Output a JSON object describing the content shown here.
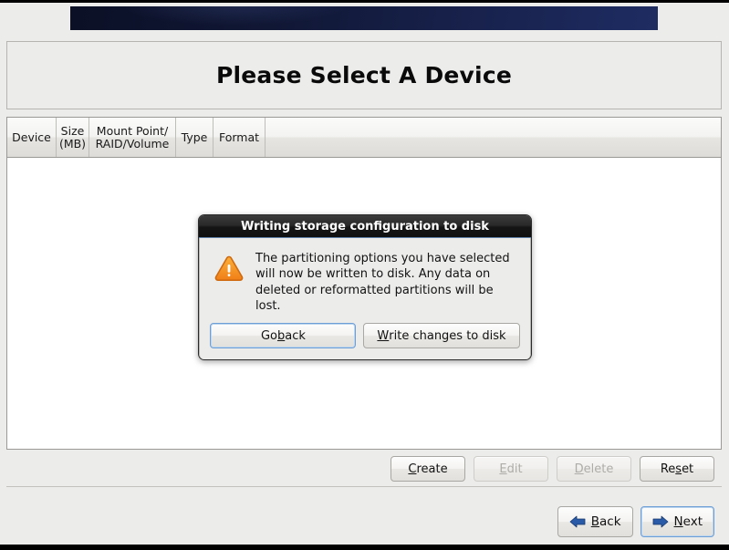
{
  "banner": {
    "name": "top-gradient-banner",
    "color": "#101735"
  },
  "header": {
    "title": "Please Select A Device"
  },
  "table": {
    "columns": [
      {
        "label": "Device"
      },
      {
        "label": "Size\n(MB)"
      },
      {
        "label": "Mount Point/\nRAID/Volume"
      },
      {
        "label": "Type"
      },
      {
        "label": "Format"
      }
    ],
    "rows": []
  },
  "actions": {
    "create": {
      "label_pre": "",
      "label_key": "C",
      "label_post": "reate",
      "disabled": false
    },
    "edit": {
      "label_pre": "",
      "label_key": "E",
      "label_post": "dit",
      "disabled": true
    },
    "delete": {
      "label_pre": "",
      "label_key": "D",
      "label_post": "elete",
      "disabled": true
    },
    "reset": {
      "label_pre": "Re",
      "label_key": "s",
      "label_post": "et",
      "disabled": false
    }
  },
  "nav": {
    "back": {
      "label_pre": "",
      "label_key": "B",
      "label_post": "ack",
      "icon": "arrow-left-icon",
      "focused": false
    },
    "next": {
      "label_pre": "",
      "label_key": "N",
      "label_post": "ext",
      "icon": "arrow-right-icon",
      "focused": true
    },
    "arrow_color": "#2a5ba8"
  },
  "dialog": {
    "title": "Writing storage configuration to disk",
    "icon": "warning-triangle-icon",
    "icon_color": "#f5871f",
    "message": "The partitioning options you have selected\nwill now be written to disk.  Any data on\ndeleted or reformatted partitions will be lost.",
    "buttons": {
      "go_back": {
        "label_pre": "Go ",
        "label_key": "b",
        "label_post": "ack",
        "focused": true
      },
      "write_changes": {
        "label_pre": "",
        "label_key": "W",
        "label_post": "rite changes to disk",
        "focused": false
      }
    }
  }
}
